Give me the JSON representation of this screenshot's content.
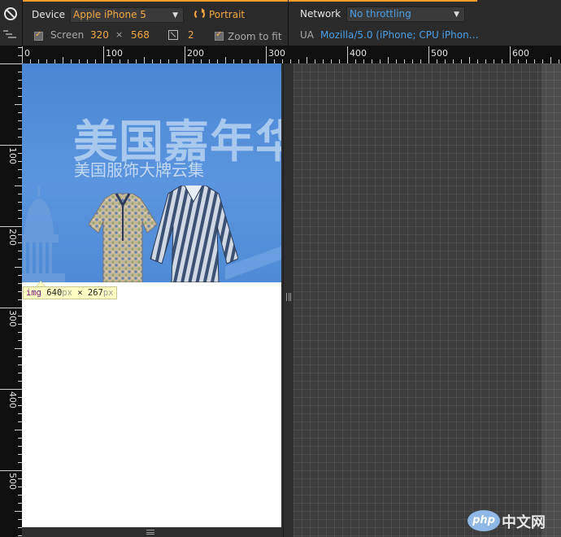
{
  "toolbar": {
    "device_label": "Device",
    "device_value": "Apple iPhone 5",
    "orientation_label": "Portrait",
    "screen_label": "Screen",
    "screen_width": "320",
    "screen_times": "×",
    "screen_height": "568",
    "pixel_ratio": "2",
    "zoom_label": "Zoom to fit",
    "network_label": "Network",
    "network_value": "No throttling",
    "ua_label": "UA",
    "ua_value": "Mozilla/5.0 (iPhone; CPU iPhon…"
  },
  "ruler": {
    "h_ticks": [
      "0",
      "100",
      "200",
      "300",
      "400",
      "500",
      "600"
    ],
    "v_ticks": [
      "100",
      "200",
      "300",
      "400",
      "500"
    ]
  },
  "page": {
    "banner_title": "美国嘉年华",
    "banner_subtitle": "美国服饰大牌云集"
  },
  "size_tooltip": {
    "tag": "img",
    "width": "640",
    "width_unit": "px",
    "times": " × ",
    "height": "267",
    "height_unit": "px"
  },
  "watermark": {
    "logo": "php",
    "text": "中文网"
  },
  "colors": {
    "accent_orange": "#f5a742",
    "accent_blue": "#4a9fe8",
    "banner_blue": "#4f8ad6"
  }
}
